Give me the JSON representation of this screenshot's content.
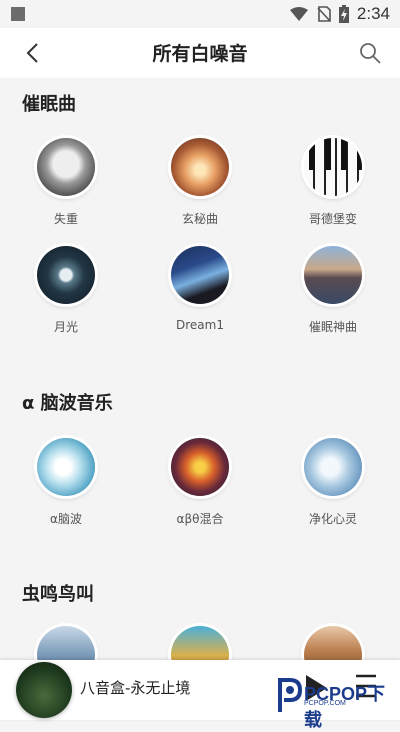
{
  "status_bar": {
    "time": "2:34",
    "icons": [
      "notification-square-icon",
      "wifi-icon",
      "no-sim-icon",
      "battery-charging-icon"
    ]
  },
  "header": {
    "title": "所有白噪音",
    "back_icon": "back-arrow-icon",
    "search_icon": "search-icon"
  },
  "sections": [
    {
      "title": "催眠曲",
      "items": [
        {
          "label": "失重",
          "icon": "astronaut-thumb"
        },
        {
          "label": "玄秘曲",
          "icon": "glow-orb-thumb"
        },
        {
          "label": "哥德堡变",
          "icon": "piano-keys-thumb"
        },
        {
          "label": "月光",
          "icon": "moon-thumb"
        },
        {
          "label": "Dream1",
          "icon": "night-sky-thumb"
        },
        {
          "label": "催眠神曲",
          "icon": "lake-swans-thumb"
        }
      ]
    },
    {
      "title": "α 脑波音乐",
      "items": [
        {
          "label": "α脑波",
          "icon": "neural-wave-thumb"
        },
        {
          "label": "αβθ混合",
          "icon": "fire-flower-thumb"
        },
        {
          "label": "净化心灵",
          "icon": "water-splash-thumb"
        }
      ]
    },
    {
      "title": "虫鸣鸟叫",
      "items": [
        {
          "label": "",
          "icon": "bird-thumb"
        },
        {
          "label": "",
          "icon": "frog-thumb"
        },
        {
          "label": "",
          "icon": "forest-thumb"
        }
      ]
    }
  ],
  "player": {
    "title": "八音盒-永无止境",
    "play_icon": "play-icon",
    "list_icon": "playlist-icon"
  },
  "watermark": {
    "text": "PCPOP下载",
    "sub": "PCPOP.COM"
  }
}
